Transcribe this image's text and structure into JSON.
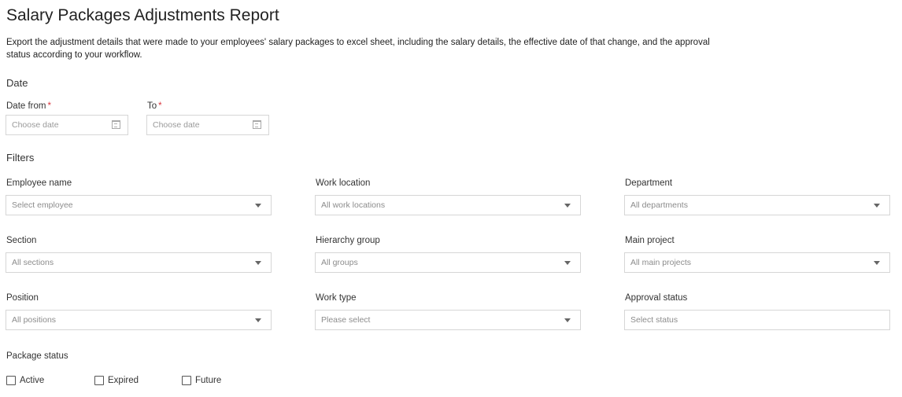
{
  "page": {
    "title": "Salary Packages Adjustments Report",
    "description": "Export the adjustment details that were made to your employees' salary packages to excel sheet, including the salary details, the effective date of that change, and the approval status according to your workflow."
  },
  "date_section": {
    "heading": "Date",
    "from": {
      "label": "Date from",
      "required_mark": "*",
      "placeholder": "Choose date"
    },
    "to": {
      "label": "To",
      "required_mark": "*",
      "placeholder": "Choose date"
    }
  },
  "filters": {
    "heading": "Filters",
    "employee_name": {
      "label": "Employee name",
      "placeholder": "Select employee"
    },
    "work_location": {
      "label": "Work location",
      "placeholder": "All work locations"
    },
    "department": {
      "label": "Department",
      "placeholder": "All departments"
    },
    "section": {
      "label": "Section",
      "placeholder": "All sections"
    },
    "hierarchy_group": {
      "label": "Hierarchy group",
      "placeholder": "All groups"
    },
    "main_project": {
      "label": "Main project",
      "placeholder": "All main projects"
    },
    "position": {
      "label": "Position",
      "placeholder": "All positions"
    },
    "work_type": {
      "label": "Work type",
      "placeholder": "Please select"
    },
    "approval_status": {
      "label": "Approval status",
      "placeholder": "Select status"
    }
  },
  "package_status": {
    "label": "Package status",
    "options": [
      {
        "label": "Active",
        "checked": false
      },
      {
        "label": "Expired",
        "checked": false
      },
      {
        "label": "Future",
        "checked": false
      }
    ]
  },
  "icons": {
    "calendar": "calendar-icon",
    "dropdown": "chevron-down-icon"
  },
  "colors": {
    "required": "#d9363e",
    "border": "#d6d6d6",
    "placeholder": "#8c8c8c"
  }
}
